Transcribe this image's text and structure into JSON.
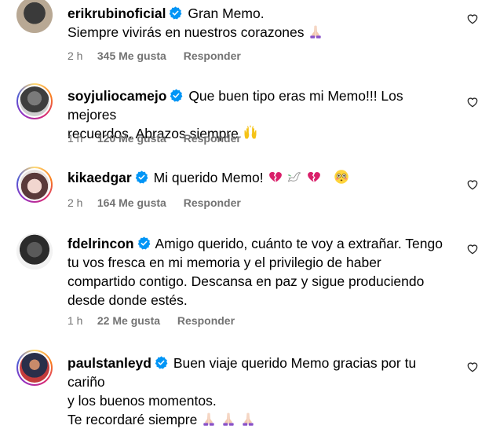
{
  "comments": [
    {
      "username": "erikrubinoficial",
      "text": "Gran Memo.\nSiempre vivirás en nuestros corazones 🙏🏻",
      "line1": "Gran Memo.",
      "line2": "Siempre vivirás en nuestros corazones",
      "time": "2 h",
      "likes": "345 Me gusta",
      "reply": "Responder"
    },
    {
      "username": "soyjuliocamejo",
      "line1": "Que buen tipo eras mi Memo!!! Los mejores",
      "line2": "recuerdos. Abrazos siempre",
      "time": "1 h",
      "likes": "120 Me gusta",
      "reply": "Responder"
    },
    {
      "username": "kikaedgar",
      "line1": "Mi querido Memo!",
      "time": "2 h",
      "likes": "164 Me gusta",
      "reply": "Responder"
    },
    {
      "username": "fdelrincon",
      "line1": "Amigo querido, cuánto te voy a extrañar. Tengo",
      "line2": "tu vos fresca en mi memoria y el privilegio de haber",
      "line3": "compartido contigo. Descansa en paz y sigue produciendo",
      "line4": "desde donde estés.",
      "time": "1 h",
      "likes": "22 Me gusta",
      "reply": "Responder"
    },
    {
      "username": "paulstanleyd",
      "line1": "Buen viaje querido Memo gracias por tu cariño",
      "line2": "y los buenos momentos.",
      "line3": "Te recordaré siempre"
    }
  ],
  "colors": {
    "verified": "#0095f6",
    "meta": "#737373",
    "broken_heart": "#d9206a"
  },
  "icons": [
    "verified-icon",
    "heart-icon",
    "praying-hands-emoji",
    "raised-hands-emoji",
    "broken-heart-emoji",
    "dove-emoji",
    "flushed-face-emoji"
  ]
}
